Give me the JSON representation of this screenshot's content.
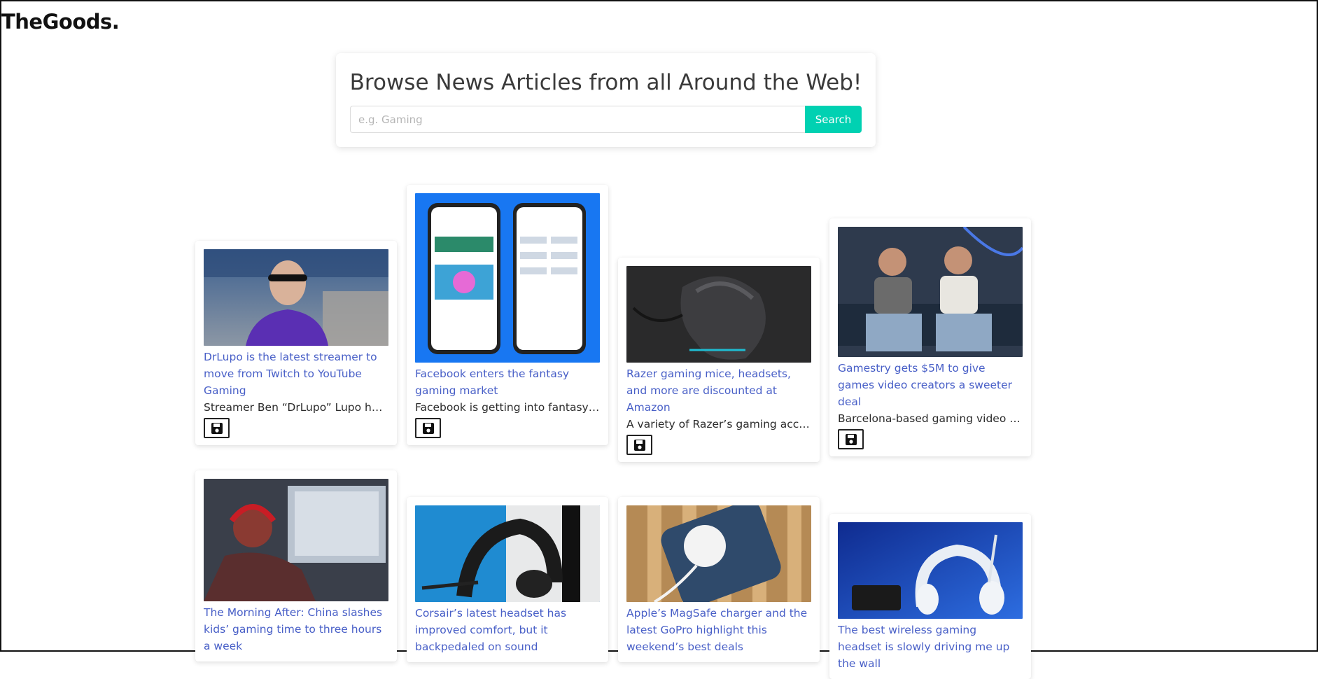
{
  "header": {
    "brand": "TheGoods."
  },
  "search": {
    "title": "Browse News Articles from all Around the Web!",
    "placeholder": "e.g. Gaming",
    "button_label": "Search"
  },
  "colors": {
    "accent": "#00d1b2",
    "link": "#485fc7"
  },
  "articles": [
    {
      "title": "DrLupo is the latest streamer to move from Twitch to YouTube Gaming",
      "description": "Streamer Ben “DrLupo” Lupo has signed",
      "image": "streamer-in-sunglasses-photo",
      "save_icon": "floppy-disk-icon"
    },
    {
      "title": "Facebook enters the fantasy gaming market",
      "description": "Facebook is getting into fantasy sports",
      "image": "fantasy-games-app-phones-photo",
      "save_icon": "floppy-disk-icon"
    },
    {
      "title": "Razer gaming mice, headsets, and more are discounted at Amazon",
      "description": "A variety of Razer’s gaming accessories",
      "image": "gaming-mouse-photo",
      "save_icon": "floppy-disk-icon"
    },
    {
      "title": "Gamestry gets $5M to give games video creators a sweeter deal",
      "description": "Barcelona-based gaming video platform",
      "image": "two-founders-photo",
      "save_icon": "floppy-disk-icon"
    },
    {
      "title": "The Morning After: China slashes kids’ gaming time to three hours a week",
      "description": "",
      "image": "kid-gaming-headphones-photo"
    },
    {
      "title": "Corsair’s latest headset has improved comfort, but it backpedaled on sound",
      "description": "",
      "image": "corsair-headset-photo"
    },
    {
      "title": "Apple’s MagSafe charger and the latest GoPro highlight this weekend’s best deals",
      "description": "",
      "image": "magsafe-charger-photo"
    },
    {
      "title": "The best wireless gaming headset is slowly driving me up the wall",
      "description": "",
      "image": "white-gaming-headset-photo"
    }
  ]
}
